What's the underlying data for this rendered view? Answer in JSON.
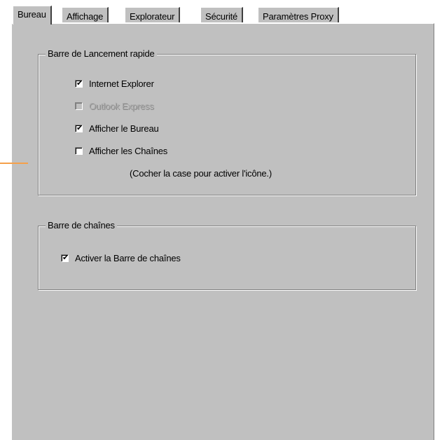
{
  "tabs": [
    {
      "label": "Bureau",
      "active": true
    },
    {
      "label": "Affichage",
      "active": false
    },
    {
      "label": "Explorateur",
      "active": false
    },
    {
      "label": "Sécurité",
      "active": false
    },
    {
      "label": "Paramètres Proxy",
      "active": false
    }
  ],
  "quick_launch": {
    "title": "Barre de Lancement rapide",
    "options": [
      {
        "label": "Internet Explorer",
        "checked": true,
        "enabled": true
      },
      {
        "label": "Outlook Express",
        "checked": false,
        "enabled": false
      },
      {
        "label": "Afficher le Bureau",
        "checked": true,
        "enabled": true
      },
      {
        "label": "Afficher les Chaînes",
        "checked": false,
        "enabled": true
      }
    ],
    "note": "(Cocher la case pour activer l'icône.)"
  },
  "channel_bar": {
    "title": "Barre de chaînes",
    "option": {
      "label": "Activer la Barre de chaînes",
      "checked": true,
      "enabled": true
    }
  },
  "colors": {
    "face": "#c0c0c0",
    "accent": "#f5a04a"
  }
}
